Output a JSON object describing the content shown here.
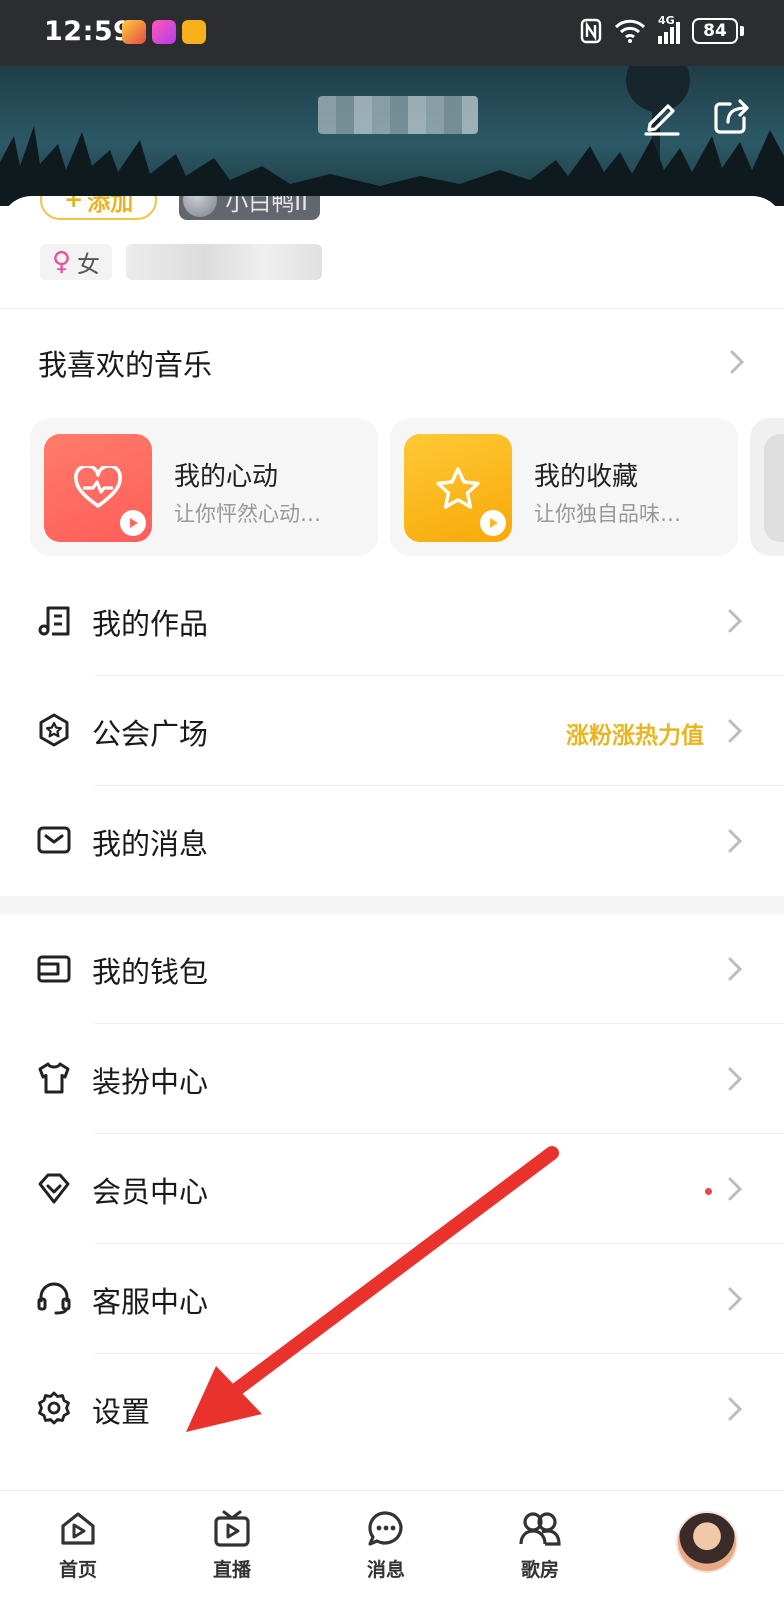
{
  "status_bar": {
    "time": "12:59",
    "network": "4G",
    "battery": "84"
  },
  "profile": {
    "add_label": "添加",
    "level_badge": "小白鸭II",
    "gender": "女"
  },
  "music": {
    "section_title": "我喜欢的音乐",
    "cards": [
      {
        "title": "我的心动",
        "subtitle": "让你怦然心动…",
        "icon": "heart-pulse-icon",
        "color": "#ff6a60"
      },
      {
        "title": "我的收藏",
        "subtitle": "让你独自品味…",
        "icon": "star-icon",
        "color": "#fbb91f"
      }
    ]
  },
  "menu_group1": [
    {
      "label": "我的作品",
      "icon": "music-list-icon"
    },
    {
      "label": "公会广场",
      "icon": "guild-icon",
      "extra": "涨粉涨热力值"
    },
    {
      "label": "我的消息",
      "icon": "mail-icon"
    }
  ],
  "menu_group2": [
    {
      "label": "我的钱包",
      "icon": "wallet-icon"
    },
    {
      "label": "装扮中心",
      "icon": "shirt-icon"
    },
    {
      "label": "会员中心",
      "icon": "diamond-icon",
      "dot": true
    },
    {
      "label": "客服中心",
      "icon": "headset-icon"
    },
    {
      "label": "设置",
      "icon": "gear-icon"
    }
  ],
  "bottom_nav": [
    {
      "label": "首页",
      "icon": "home-play-icon"
    },
    {
      "label": "直播",
      "icon": "tv-icon"
    },
    {
      "label": "消息",
      "icon": "chat-icon"
    },
    {
      "label": "歌房",
      "icon": "people-icon"
    }
  ],
  "colors": {
    "accent_yellow": "#e9b51f",
    "arrow_red": "#e8322b",
    "dot_red": "#e14b43"
  }
}
